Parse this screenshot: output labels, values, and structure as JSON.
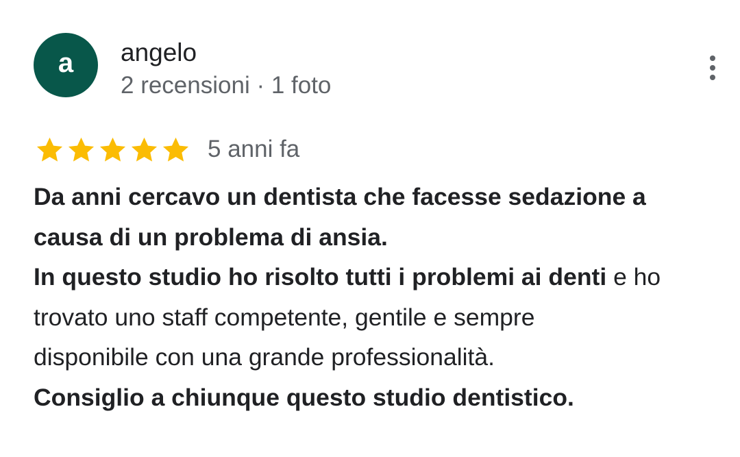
{
  "review": {
    "avatar_initial": "a",
    "author_name": "angelo",
    "author_meta": "2 recensioni · 1 foto",
    "rating": 5,
    "rating_max": 5,
    "date": "5 anni fa",
    "text": {
      "line1": "Da anni cercavo un dentista che facesse sedazione a",
      "line2": "causa di un problema di ansia.",
      "line3_bold": "In questo studio ho risolto tutti i problemi ai denti",
      "line3_regular": " e ho",
      "line4": "trovato uno staff competente, gentile e sempre",
      "line5": "disponibile con una grande professionalità.",
      "line6": "Consiglio a chiunque questo studio dentistico."
    }
  },
  "colors": {
    "avatar_bg": "#08574a",
    "star": "#fbbc04",
    "secondary_text": "#5f6368",
    "primary_text": "#202124"
  },
  "icons": {
    "menu": "more-vert-icon",
    "star": "star-icon"
  }
}
